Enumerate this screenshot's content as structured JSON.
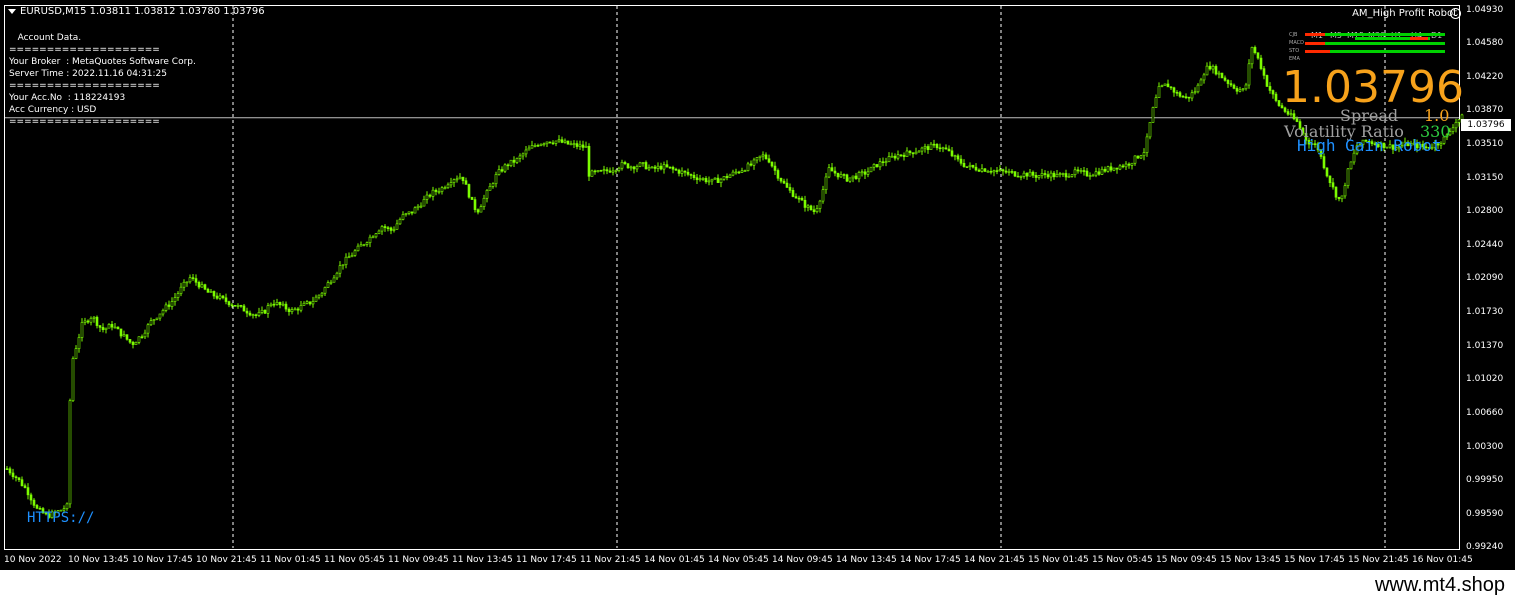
{
  "header": {
    "symbol_line": "EURUSD,M15  1.03811 1.03812 1.03780 1.03796",
    "ea_name": "AM_High Profit Robot"
  },
  "account": {
    "lines": [
      "   Account Data.",
      "====================",
      "Your Broker  : MetaQuotes Software Corp.",
      "Server Time : 2022.11.16 04:31:25",
      "====================",
      "Your Acc.No  : 118224193",
      "Acc Currency : USD",
      "===================="
    ]
  },
  "panel": {
    "price": "1.03796",
    "spread_label": "Spread",
    "spread_value": "1.0",
    "volatility_label": "Volatility Ratio",
    "volatility_value": "330",
    "robot_label": "High Gain Robot",
    "https_label": "HTTPS://",
    "timeframes": [
      "M1",
      "M5",
      "M15",
      "M30",
      "H1",
      "H4",
      "D1"
    ],
    "indicator_rows": [
      "CJB",
      "MACD",
      "STO",
      "EMA"
    ]
  },
  "colors": {
    "candle": "#7cfc00",
    "accent": "#f7a21b",
    "robot": "#1e90ff",
    "bar_red": "#ff2a00",
    "bar_green": "#00d000"
  },
  "current_price_tag": "1.03796",
  "chart_data": {
    "type": "candlestick",
    "title": "EURUSD,M15",
    "ylim": [
      0.9924,
      1.0498
    ],
    "y_ticks": [
      "1.04930",
      "1.04580",
      "1.04220",
      "1.03870",
      "1.03510",
      "1.03150",
      "1.02800",
      "1.02440",
      "1.02090",
      "1.01730",
      "1.01370",
      "1.01020",
      "1.00660",
      "1.00300",
      "0.99950",
      "0.99590",
      "0.99240"
    ],
    "x_ticks": [
      "10 Nov 2022",
      "10 Nov 13:45",
      "10 Nov 17:45",
      "10 Nov 21:45",
      "11 Nov 01:45",
      "11 Nov 05:45",
      "11 Nov 09:45",
      "11 Nov 13:45",
      "11 Nov 17:45",
      "11 Nov 21:45",
      "14 Nov 01:45",
      "14 Nov 05:45",
      "14 Nov 09:45",
      "14 Nov 13:45",
      "14 Nov 17:45",
      "14 Nov 21:45",
      "15 Nov 01:45",
      "15 Nov 05:45",
      "15 Nov 09:45",
      "15 Nov 13:45",
      "15 Nov 17:45",
      "15 Nov 21:45",
      "16 Nov 01:45"
    ],
    "current_price": 1.03796,
    "close_path": [
      [
        0,
        1.0008
      ],
      [
        10,
        0.9998
      ],
      [
        20,
        0.9985
      ],
      [
        30,
        0.9965
      ],
      [
        40,
        0.9958
      ],
      [
        50,
        0.9962
      ],
      [
        60,
        0.9968
      ],
      [
        63,
        1.008
      ],
      [
        66,
        1.0125
      ],
      [
        75,
        1.016
      ],
      [
        85,
        1.017
      ],
      [
        95,
        1.0155
      ],
      [
        105,
        1.016
      ],
      [
        115,
        1.015
      ],
      [
        125,
        1.014
      ],
      [
        135,
        1.015
      ],
      [
        145,
        1.0165
      ],
      [
        155,
        1.0175
      ],
      [
        165,
        1.0185
      ],
      [
        175,
        1.02
      ],
      [
        183,
        1.021
      ],
      [
        190,
        1.0205
      ],
      [
        200,
        1.0195
      ],
      [
        210,
        1.019
      ],
      [
        220,
        1.0185
      ],
      [
        230,
        1.018
      ],
      [
        240,
        1.0175
      ],
      [
        250,
        1.017
      ],
      [
        258,
        1.0175
      ],
      [
        265,
        1.0185
      ],
      [
        275,
        1.018
      ],
      [
        285,
        1.0175
      ],
      [
        295,
        1.018
      ],
      [
        305,
        1.0185
      ],
      [
        315,
        1.0195
      ],
      [
        325,
        1.021
      ],
      [
        335,
        1.0225
      ],
      [
        345,
        1.0235
      ],
      [
        355,
        1.0245
      ],
      [
        365,
        1.0255
      ],
      [
        375,
        1.0265
      ],
      [
        385,
        1.026
      ],
      [
        395,
        1.0275
      ],
      [
        405,
        1.028
      ],
      [
        415,
        1.029
      ],
      [
        425,
        1.03
      ],
      [
        435,
        1.0305
      ],
      [
        445,
        1.0315
      ],
      [
        455,
        1.0318
      ],
      [
        465,
        1.029
      ],
      [
        470,
        1.028
      ],
      [
        480,
        1.03
      ],
      [
        490,
        1.032
      ],
      [
        500,
        1.033
      ],
      [
        510,
        1.0335
      ],
      [
        520,
        1.0345
      ],
      [
        530,
        1.0352
      ],
      [
        540,
        1.0355
      ],
      [
        550,
        1.0355
      ],
      [
        560,
        1.0352
      ],
      [
        570,
        1.035
      ],
      [
        580,
        1.0348
      ],
      [
        582,
        1.032
      ],
      [
        595,
        1.0322
      ],
      [
        605,
        1.0325
      ],
      [
        615,
        1.033
      ],
      [
        625,
        1.0328
      ],
      [
        635,
        1.033
      ],
      [
        645,
        1.0325
      ],
      [
        655,
        1.0328
      ],
      [
        665,
        1.0325
      ],
      [
        675,
        1.0322
      ],
      [
        685,
        1.0318
      ],
      [
        695,
        1.0315
      ],
      [
        705,
        1.0312
      ],
      [
        715,
        1.0315
      ],
      [
        725,
        1.032
      ],
      [
        735,
        1.0325
      ],
      [
        745,
        1.033
      ],
      [
        755,
        1.034
      ],
      [
        762,
        1.0335
      ],
      [
        770,
        1.032
      ],
      [
        780,
        1.0305
      ],
      [
        790,
        1.0295
      ],
      [
        800,
        1.0285
      ],
      [
        808,
        1.028
      ],
      [
        815,
        1.03
      ],
      [
        822,
        1.0325
      ],
      [
        830,
        1.032
      ],
      [
        840,
        1.0315
      ],
      [
        850,
        1.0318
      ],
      [
        860,
        1.0322
      ],
      [
        870,
        1.033
      ],
      [
        880,
        1.0335
      ],
      [
        890,
        1.034
      ],
      [
        900,
        1.0342
      ],
      [
        910,
        1.0345
      ],
      [
        920,
        1.0348
      ],
      [
        930,
        1.035
      ],
      [
        940,
        1.0345
      ],
      [
        950,
        1.0335
      ],
      [
        960,
        1.0328
      ],
      [
        970,
        1.0326
      ],
      [
        980,
        1.0325
      ],
      [
        990,
        1.0323
      ],
      [
        1000,
        1.0322
      ],
      [
        1010,
        1.032
      ],
      [
        1020,
        1.032
      ],
      [
        1030,
        1.0318
      ],
      [
        1040,
        1.032
      ],
      [
        1050,
        1.0318
      ],
      [
        1060,
        1.032
      ],
      [
        1070,
        1.0322
      ],
      [
        1080,
        1.032
      ],
      [
        1090,
        1.0322
      ],
      [
        1100,
        1.0325
      ],
      [
        1110,
        1.0328
      ],
      [
        1120,
        1.033
      ],
      [
        1130,
        1.0338
      ],
      [
        1138,
        1.0345
      ],
      [
        1145,
        1.0385
      ],
      [
        1152,
        1.041
      ],
      [
        1160,
        1.0415
      ],
      [
        1170,
        1.0405
      ],
      [
        1180,
        1.04
      ],
      [
        1190,
        1.041
      ],
      [
        1195,
        1.0425
      ],
      [
        1202,
        1.0435
      ],
      [
        1210,
        1.0428
      ],
      [
        1220,
        1.0418
      ],
      [
        1230,
        1.041
      ],
      [
        1238,
        1.0408
      ],
      [
        1245,
        1.0455
      ],
      [
        1252,
        1.044
      ],
      [
        1260,
        1.0415
      ],
      [
        1270,
        1.0395
      ],
      [
        1280,
        1.0385
      ],
      [
        1290,
        1.0375
      ],
      [
        1300,
        1.0355
      ],
      [
        1310,
        1.035
      ],
      [
        1320,
        1.032
      ],
      [
        1328,
        1.03
      ],
      [
        1334,
        1.029
      ],
      [
        1340,
        1.032
      ],
      [
        1350,
        1.035
      ],
      [
        1360,
        1.0355
      ],
      [
        1370,
        1.0352
      ],
      [
        1380,
        1.035
      ],
      [
        1390,
        1.0348
      ],
      [
        1400,
        1.0352
      ],
      [
        1410,
        1.035
      ],
      [
        1420,
        1.0348
      ],
      [
        1430,
        1.0352
      ],
      [
        1440,
        1.036
      ],
      [
        1448,
        1.0375
      ],
      [
        1455,
        1.038
      ]
    ]
  }
}
